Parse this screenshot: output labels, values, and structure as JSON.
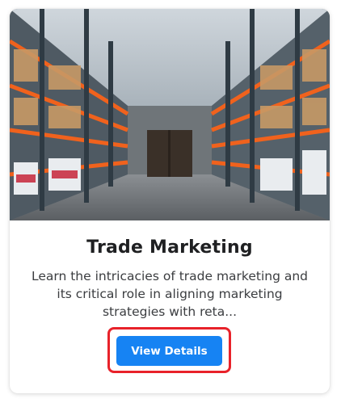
{
  "card": {
    "image_alt": "warehouse-aisle",
    "title": "Trade Marketing",
    "description_lines": [
      "Learn the intricacies of trade marketing and",
      "its critical role in aligning marketing",
      "strategies with reta..."
    ],
    "button_label": "View Details"
  },
  "colors": {
    "button": "#1683f3",
    "highlight": "#e8222a",
    "title": "#1f2022"
  }
}
